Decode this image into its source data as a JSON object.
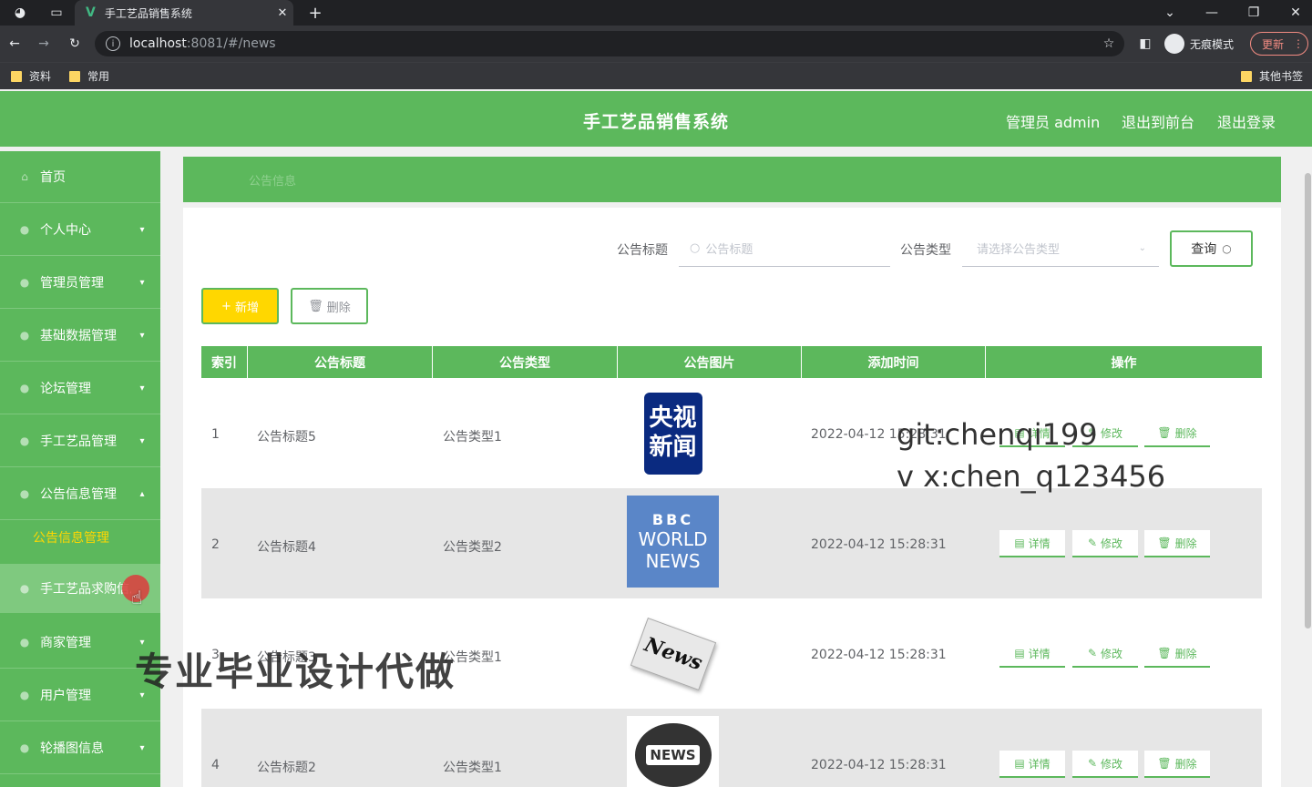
{
  "browser": {
    "tab_title": "手工艺品销售系统",
    "tab_close": "✕",
    "new_tab": "+",
    "url_host": "localhost",
    "url_path": ":8081/#/news",
    "incognito_label": "无痕模式",
    "update_label": "更新",
    "bookmarks": [
      "资料",
      "常用"
    ],
    "other_bookmarks": "其他书签"
  },
  "header": {
    "title": "手工艺品销售系统",
    "admin": "管理员 admin",
    "back_front": "退出到前台",
    "logout": "退出登录"
  },
  "sidebar": {
    "items": [
      {
        "label": "首页"
      },
      {
        "label": "个人中心"
      },
      {
        "label": "管理员管理"
      },
      {
        "label": "基础数据管理"
      },
      {
        "label": "论坛管理"
      },
      {
        "label": "手工艺品管理"
      },
      {
        "label": "公告信息管理"
      }
    ],
    "submenu_active": "公告信息管理",
    "submenu_hover": "手工艺品求购信息",
    "items_after": [
      {
        "label": "商家管理"
      },
      {
        "label": "用户管理"
      },
      {
        "label": "轮播图信息"
      }
    ]
  },
  "breadcrumb": "公告信息",
  "search": {
    "title_label": "公告标题",
    "title_placeholder": "公告标题",
    "type_label": "公告类型",
    "type_placeholder": "请选择公告类型",
    "query_button": "查询"
  },
  "actions": {
    "add": "新增",
    "delete": "删除"
  },
  "table": {
    "headers": [
      "索引",
      "公告标题",
      "公告类型",
      "公告图片",
      "添加时间",
      "操作"
    ],
    "rows": [
      {
        "index": "1",
        "title": "公告标题5",
        "type": "公告类型1",
        "time": "2022-04-12 15:28:31",
        "image": "cctv-news"
      },
      {
        "index": "2",
        "title": "公告标题4",
        "type": "公告类型2",
        "time": "2022-04-12 15:28:31",
        "image": "bbc-world-news"
      },
      {
        "index": "3",
        "title": "公告标题3",
        "type": "公告类型1",
        "time": "2022-04-12 15:28:31",
        "image": "news-paper"
      },
      {
        "index": "4",
        "title": "公告标题2",
        "type": "公告类型1",
        "time": "2022-04-12 15:28:31",
        "image": "news-globe"
      }
    ],
    "op_detail": "详情",
    "op_edit": "修改",
    "op_delete": "删除"
  },
  "images": {
    "cctv_line1": "央视",
    "cctv_line2": "新闻",
    "bbc_top": "BBC",
    "bbc_mid": "WORLD",
    "bbc_bot": "NEWS",
    "paper": "News",
    "globe": "NEWS"
  },
  "overlay": {
    "git": "git:chenqi199",
    "wechat": "v x:chen_q123456",
    "promo": "专业毕业设计代做"
  },
  "colors": {
    "brand_green": "#5cb85c",
    "accent_yellow": "#ffd700"
  }
}
